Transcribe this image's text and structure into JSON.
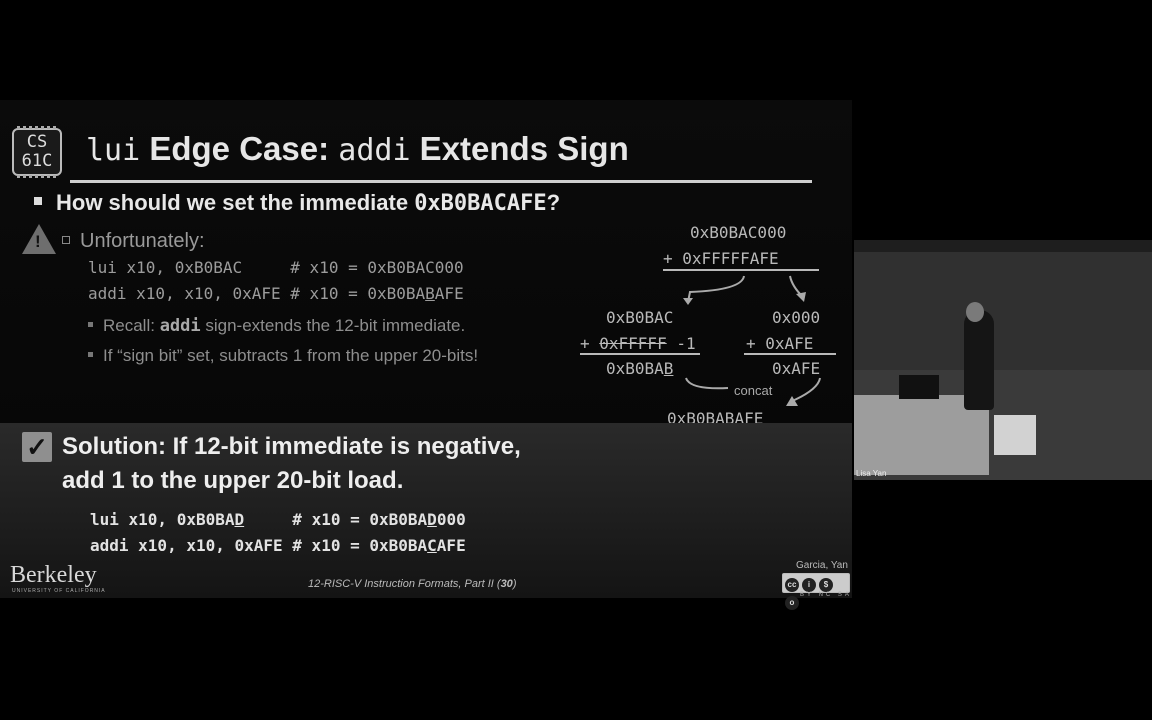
{
  "slide": {
    "logo_line1": "CS",
    "logo_line2": "61C",
    "title_mono1": "lui",
    "title_text1": " Edge Case: ",
    "title_mono2": "addi",
    "title_text2": " Extends Sign",
    "bullet_text": "How should we set the immediate ",
    "bullet_mono": "0xB0BACAFE",
    "bullet_end": "?",
    "warning_symbol": "!",
    "sub_unfortunately": "Unfortunately:",
    "code_line1": "lui x10, 0xB0BAC     # x10 = 0xB0BAC000",
    "code_line2_a": "addi x10, x10, 0xAFE # x10 = 0xB0BA",
    "code_line2_b": "B",
    "code_line2_c": "AFE",
    "recall_a": "Recall: ",
    "recall_mono": "addi",
    "recall_b": " sign-extends the 12-bit immediate.",
    "signbit": "If “sign bit” set, subtracts 1 from the upper 20-bits!",
    "calc_top": "0xB0BAC000",
    "calc_plus": "+ 0xFFFFFAFE",
    "calc_left1": "0xB0BAC",
    "calc_left2_a": "+ ",
    "calc_left2_b": "0xFFFFF",
    "calc_left2_c": " -1",
    "calc_left3_a": "0xB0BA",
    "calc_left3_b": "B",
    "calc_right1": "0x000",
    "calc_right2": "+ 0xAFE",
    "calc_right3": "0xAFE",
    "concat": "concat",
    "calc_result_a": "0xB0BA",
    "calc_result_b": "B",
    "calc_result_c": "AFE",
    "check_symbol": "✓",
    "solution_line1": "Solution: If 12-bit immediate is negative,",
    "solution_line2": "add 1 to the upper 20-bit load.",
    "sol_code1_a": "lui x10, 0xB0BA",
    "sol_code1_b": "D",
    "sol_code1_c": "     # x10 = 0xB0BA",
    "sol_code1_d": "D",
    "sol_code1_e": "000",
    "sol_code2_a": "addi x10, x10, 0xAFE # x10 = 0xB0BA",
    "sol_code2_b": "C",
    "sol_code2_c": "AFE",
    "berkeley": "Berkeley",
    "berkeley_sub": "UNIVERSITY OF CALIFORNIA",
    "footer_a": "12-RISC-V Instruction Formats, Part II (",
    "footer_num": "30",
    "footer_b": ")",
    "authors": "Garcia, Yan",
    "cc_labels": "BY NC SA"
  },
  "video": {
    "label": "Lisa Yan"
  }
}
